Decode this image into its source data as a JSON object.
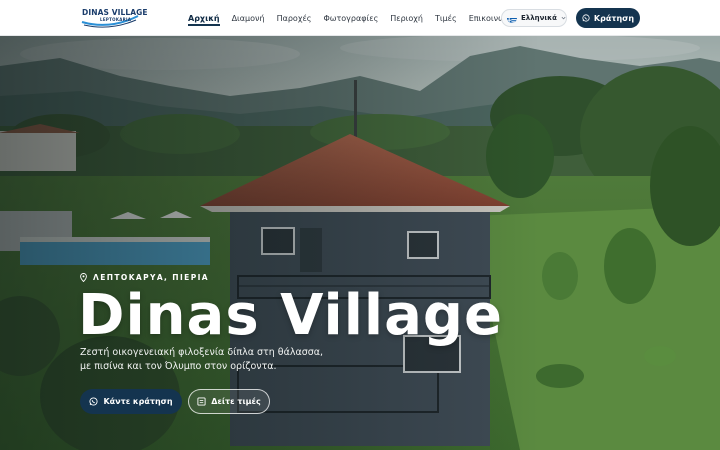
{
  "brand": {
    "logo_title": "DINAS VILLAGE",
    "logo_subtitle": "LEPTOKARIA"
  },
  "nav": {
    "items": [
      {
        "label": "Αρχική",
        "active": true
      },
      {
        "label": "Διαμονή",
        "active": false
      },
      {
        "label": "Παροχές",
        "active": false
      },
      {
        "label": "Φωτογραφίες",
        "active": false
      },
      {
        "label": "Περιοχή",
        "active": false
      },
      {
        "label": "Τιμές",
        "active": false
      },
      {
        "label": "Επικοινωνία",
        "active": false
      }
    ]
  },
  "language": {
    "selected": "Ελληνικά",
    "flag_icon": "greek-flag-icon"
  },
  "header_cta": {
    "label": "Κράτηση",
    "icon": "whatsapp-icon"
  },
  "hero": {
    "location": "ΛΕΠΤΟΚΑΡΥΑ, ΠΙΕΡΙΑ",
    "location_icon": "map-pin-icon",
    "title": "Dinas Village",
    "subtitle_line1": "Ζεστή οικογενειακή φιλοξενία δίπλα στη θάλασσα,",
    "subtitle_line2": "με πισίνα και τον Όλυμπο στον ορίζοντα.",
    "primary_button": "Κάντε κράτηση",
    "primary_icon": "whatsapp-icon",
    "secondary_button": "Δείτε τιμές",
    "secondary_icon": "price-list-icon"
  },
  "colors": {
    "primary": "#14344f",
    "header_bg": "#ffffff",
    "nav_text": "#2e3640",
    "hero_text": "#ffffff"
  }
}
